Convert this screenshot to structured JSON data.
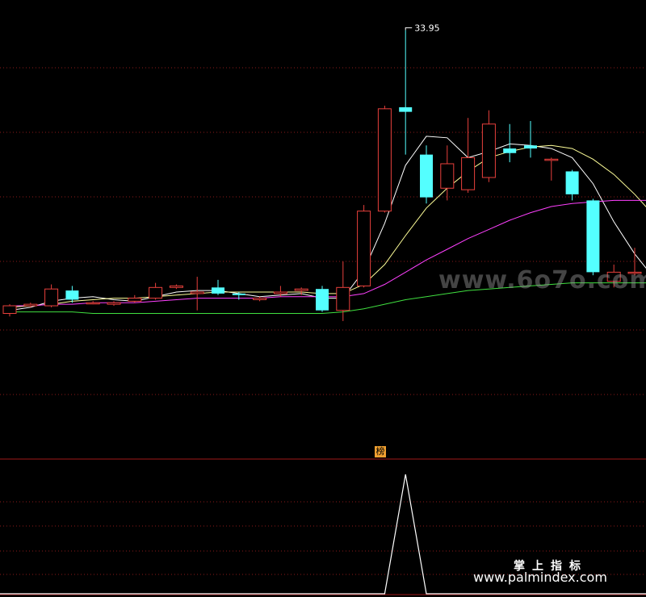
{
  "max_price_label": "33.95",
  "indicator_badge": "榜",
  "watermark_text": "www.6o7o.com",
  "brand_cn": "掌上指标",
  "brand_url": "www.palmindex.com",
  "colors": {
    "background": "#000000",
    "up": "#e8403c",
    "down": "#54ffff",
    "ma_short": "#ffffff",
    "ma_mid": "#ffff99",
    "ma_long": "#ff40ff",
    "ma_longest": "#40e040",
    "grid": "#8b1a1a",
    "signal": "#ffffff"
  },
  "chart_data": [
    {
      "type": "candlestick",
      "y_range": [
        14.0,
        35.5
      ],
      "candles": [
        {
          "o": 15.4,
          "c": 15.9,
          "h": 16.0,
          "l": 15.2
        },
        {
          "o": 15.9,
          "c": 16.0,
          "h": 16.1,
          "l": 15.8
        },
        {
          "o": 15.9,
          "c": 17.0,
          "h": 17.3,
          "l": 15.8
        },
        {
          "o": 16.9,
          "c": 16.3,
          "h": 17.2,
          "l": 16.1
        },
        {
          "o": 16.1,
          "c": 16.1,
          "h": 16.2,
          "l": 16.0
        },
        {
          "o": 16.0,
          "c": 16.1,
          "h": 16.2,
          "l": 15.9
        },
        {
          "o": 16.2,
          "c": 16.4,
          "h": 16.6,
          "l": 16.1
        },
        {
          "o": 16.4,
          "c": 17.1,
          "h": 17.4,
          "l": 16.3
        },
        {
          "o": 17.1,
          "c": 17.2,
          "h": 17.3,
          "l": 17.0
        },
        {
          "o": 16.7,
          "c": 16.8,
          "h": 17.8,
          "l": 15.6
        },
        {
          "o": 17.1,
          "c": 16.7,
          "h": 17.6,
          "l": 16.6
        },
        {
          "o": 16.7,
          "c": 16.6,
          "h": 16.8,
          "l": 16.3
        },
        {
          "o": 16.3,
          "c": 16.4,
          "h": 16.5,
          "l": 16.2
        },
        {
          "o": 16.7,
          "c": 16.8,
          "h": 17.2,
          "l": 16.5
        },
        {
          "o": 16.9,
          "c": 17.0,
          "h": 17.1,
          "l": 16.6
        },
        {
          "o": 17.0,
          "c": 15.6,
          "h": 17.2,
          "l": 15.5
        },
        {
          "o": 15.6,
          "c": 17.1,
          "h": 18.8,
          "l": 14.9
        },
        {
          "o": 17.2,
          "c": 22.1,
          "h": 22.5,
          "l": 17.1
        },
        {
          "o": 22.1,
          "c": 28.8,
          "h": 29.0,
          "l": 22.0
        },
        {
          "o": 28.9,
          "c": 28.6,
          "h": 33.95,
          "l": 25.8
        },
        {
          "o": 25.8,
          "c": 23.0,
          "h": 26.4,
          "l": 22.6
        },
        {
          "o": 23.6,
          "c": 25.2,
          "h": 26.4,
          "l": 22.8
        },
        {
          "o": 23.5,
          "c": 25.6,
          "h": 28.2,
          "l": 23.3
        },
        {
          "o": 24.3,
          "c": 27.8,
          "h": 28.7,
          "l": 24.0
        },
        {
          "o": 26.2,
          "c": 25.9,
          "h": 27.8,
          "l": 25.3
        },
        {
          "o": 26.4,
          "c": 26.2,
          "h": 28.0,
          "l": 25.6
        },
        {
          "o": 25.5,
          "c": 25.5,
          "h": 25.6,
          "l": 24.1
        },
        {
          "o": 24.7,
          "c": 23.2,
          "h": 24.8,
          "l": 22.8
        },
        {
          "o": 22.8,
          "c": 18.1,
          "h": 22.9,
          "l": 17.9
        },
        {
          "o": 17.5,
          "c": 18.1,
          "h": 18.6,
          "l": 17.1
        },
        {
          "o": 18.1,
          "c": 18.1,
          "h": 19.7,
          "l": 17.9
        },
        {
          "o": 17.9,
          "c": 16.8,
          "h": 18.0,
          "l": 15.8
        }
      ],
      "ma_lines": [
        {
          "name": "ma_short",
          "values": [
            15.6,
            15.8,
            16.2,
            16.4,
            16.5,
            16.3,
            16.2,
            16.5,
            16.8,
            16.9,
            16.9,
            16.7,
            16.5,
            16.6,
            16.7,
            16.4,
            16.4,
            18.2,
            21.3,
            25.1,
            27.0,
            26.9,
            25.6,
            26.0,
            26.5,
            26.4,
            26.2,
            25.6,
            23.9,
            21.4,
            19.3,
            17.6
          ]
        },
        {
          "name": "ma_mid",
          "values": [
            15.8,
            15.9,
            16.0,
            16.2,
            16.3,
            16.4,
            16.4,
            16.5,
            16.6,
            16.7,
            16.8,
            16.8,
            16.8,
            16.8,
            16.8,
            16.7,
            16.7,
            17.3,
            18.6,
            20.5,
            22.3,
            23.6,
            24.7,
            25.6,
            26.0,
            26.3,
            26.4,
            26.2,
            25.5,
            24.5,
            23.2,
            21.7
          ]
        },
        {
          "name": "ma_long",
          "values": [
            15.9,
            15.9,
            16.0,
            16.0,
            16.1,
            16.1,
            16.1,
            16.2,
            16.3,
            16.4,
            16.4,
            16.4,
            16.4,
            16.5,
            16.5,
            16.5,
            16.5,
            16.7,
            17.3,
            18.1,
            18.9,
            19.6,
            20.3,
            20.9,
            21.5,
            22.0,
            22.4,
            22.6,
            22.7,
            22.8,
            22.8,
            22.8
          ]
        },
        {
          "name": "ma_longest",
          "values": [
            15.5,
            15.5,
            15.5,
            15.5,
            15.4,
            15.4,
            15.4,
            15.4,
            15.4,
            15.4,
            15.4,
            15.4,
            15.4,
            15.4,
            15.4,
            15.4,
            15.5,
            15.7,
            16.0,
            16.3,
            16.5,
            16.7,
            16.9,
            17.0,
            17.1,
            17.2,
            17.3,
            17.4,
            17.4,
            17.4,
            17.4,
            17.4
          ]
        }
      ]
    },
    {
      "type": "line",
      "name": "signal",
      "values": [
        0,
        0,
        0,
        0,
        0,
        0,
        0,
        0,
        0,
        0,
        0,
        0,
        0,
        0,
        0,
        0,
        0,
        0,
        0,
        1,
        0,
        0,
        0,
        0,
        0,
        0,
        0,
        0,
        0,
        0,
        0,
        0
      ]
    }
  ]
}
